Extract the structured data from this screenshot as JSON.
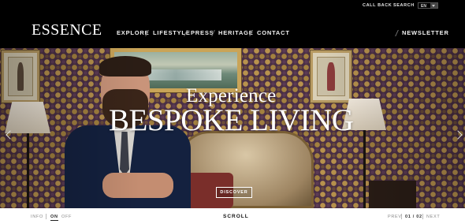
{
  "utility": {
    "call_back": "CALL BACK",
    "search": "SEARCH",
    "language": "EN"
  },
  "header": {
    "logo": "ESSENCE",
    "nav": [
      "EXPLORE",
      "LIFESTYLE",
      "PRESS",
      "HERITAGE",
      "CONTACT"
    ],
    "newsletter": "NEWSLETTER"
  },
  "hero": {
    "headline_small": "Experience",
    "headline_large": "BESPOKE LIVING",
    "cta": "DISCOVER"
  },
  "footer": {
    "info": "INFO",
    "on": "ON",
    "off": "OFF",
    "scroll": "SCROLL",
    "prev": "PREV",
    "counter": "01 / 02",
    "next": "NEXT"
  },
  "colors": {
    "background": "#000000",
    "accent_gold": "#b8924d",
    "wallpaper": "#4a2f45"
  }
}
